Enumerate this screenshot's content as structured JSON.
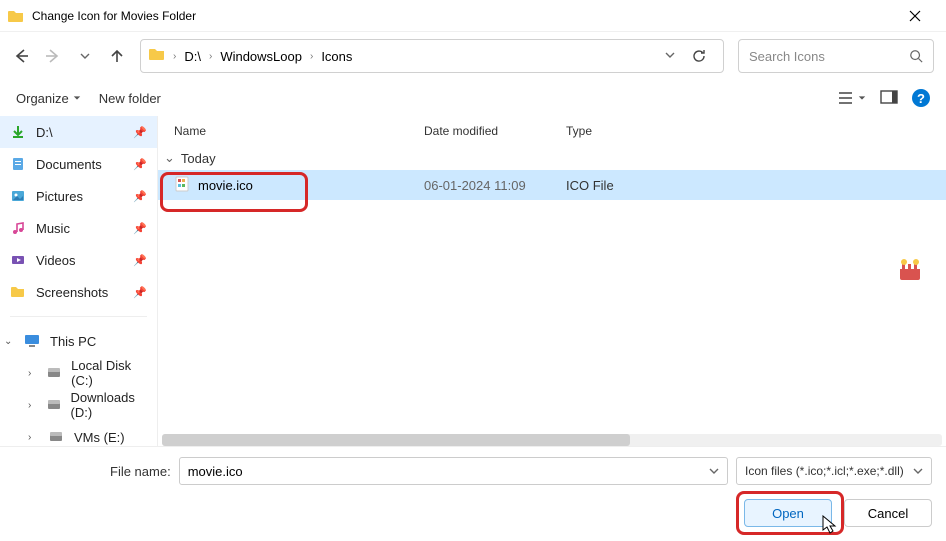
{
  "titlebar": {
    "title": "Change Icon for Movies Folder"
  },
  "nav": {
    "address_segments": [
      "D:\\",
      "WindowsLoop",
      "Icons"
    ],
    "search_placeholder": "Search Icons"
  },
  "toolbar": {
    "organize": "Organize",
    "new_folder": "New folder"
  },
  "sidebar": {
    "quick": [
      {
        "label": "D:\\",
        "icon": "download",
        "sel": true
      },
      {
        "label": "Documents",
        "icon": "folder"
      },
      {
        "label": "Pictures",
        "icon": "pictures"
      },
      {
        "label": "Music",
        "icon": "music"
      },
      {
        "label": "Videos",
        "icon": "videos"
      },
      {
        "label": "Screenshots",
        "icon": "folder"
      }
    ],
    "thispc_label": "This PC",
    "drives": [
      {
        "label": "Local Disk (C:)"
      },
      {
        "label": "Downloads (D:)"
      },
      {
        "label": "VMs (E:)"
      }
    ]
  },
  "columns": {
    "name": "Name",
    "date": "Date modified",
    "type": "Type"
  },
  "group": {
    "label": "Today"
  },
  "files": [
    {
      "name": "movie.ico",
      "date": "06-01-2024 11:09",
      "type": "ICO File"
    }
  ],
  "bottom": {
    "filename_label": "File name:",
    "filename_value": "movie.ico",
    "filter": "Icon files (*.ico;*.icl;*.exe;*.dll)",
    "open": "Open",
    "cancel": "Cancel"
  }
}
